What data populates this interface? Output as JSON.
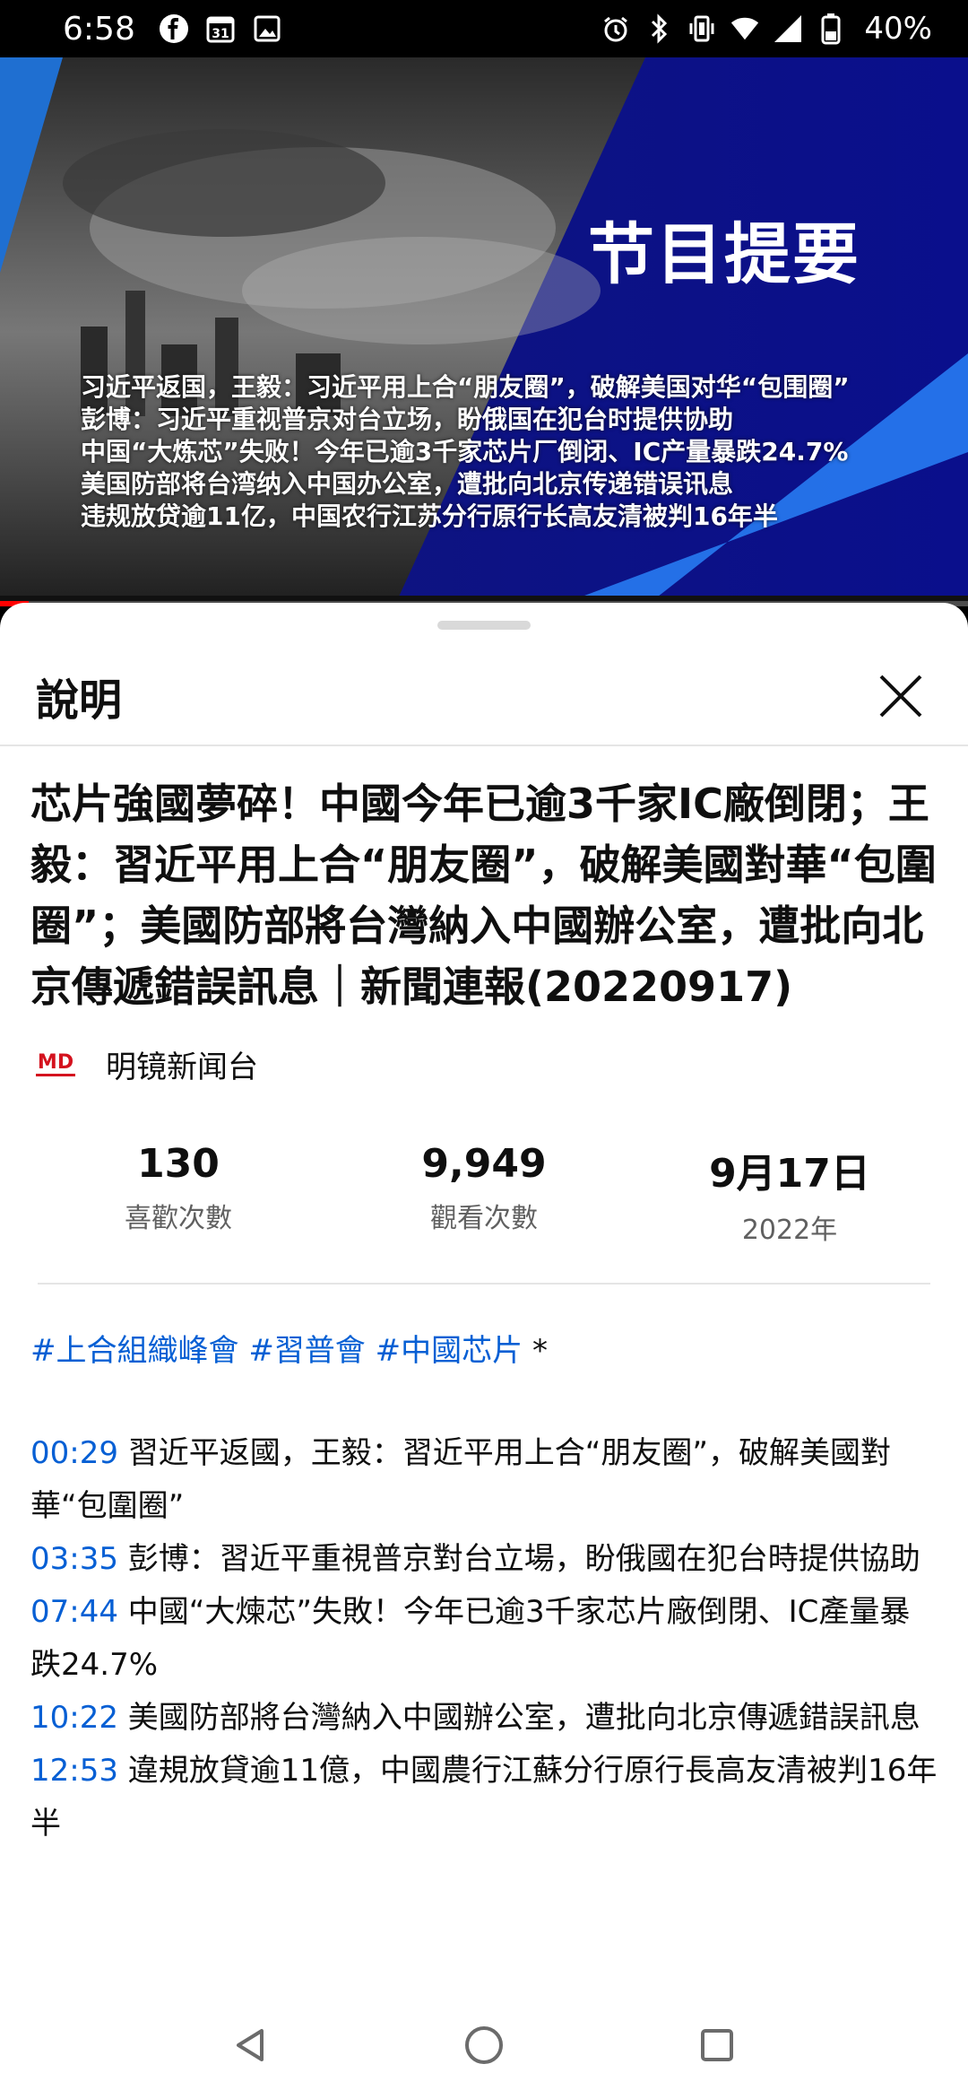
{
  "status_bar": {
    "time": "6:58",
    "left_icons": [
      "facebook-icon",
      "calendar-icon",
      "image-icon"
    ],
    "calendar_day": "31",
    "right_icons": [
      "alarm-icon",
      "bluetooth-icon",
      "vibrate-icon",
      "wifi-icon",
      "signal-icon",
      "battery-icon"
    ],
    "battery": "40%"
  },
  "video": {
    "title_overlay": "节目提要",
    "lines": [
      "习近平返国，王毅：习近平用上合“朋友圈”，破解美国对华“包围圈”",
      "彭博：习近平重视普京对台立场，盼俄国在犯台时提供协助",
      "中国“大炼芯”失败！今年已逾3千家芯片厂倒闭、IC产量暴跌24.7%",
      "美国防部将台湾纳入中国办公室，遭批向北京传递错误讯息",
      "违规放贷逾11亿，中国农行江苏分行原行长高友清被判16年半"
    ],
    "progress_fraction": 0.03,
    "progress_color": "#ff0000"
  },
  "sheet": {
    "header_title": "說明",
    "video_title": "芯片強國夢碎！中國今年已逾3千家IC廠倒閉；王毅：習近平用上合“朋友圈”，破解美國對華“包圍圈”；美國防部將台灣納入中國辦公室，遭批向北京傳遞錯誤訊息｜新聞連報(20220917)",
    "channel_name": "明镜新闻台",
    "stats": {
      "likes_value": "130",
      "likes_label": "喜歡次數",
      "views_value": "9,949",
      "views_label": "觀看次數",
      "date_value": "9月17日",
      "date_year": "2022年"
    },
    "hashtags": [
      "#上合組織峰會",
      "#習普會",
      "#中國芯片"
    ],
    "hashtag_suffix": "*",
    "chapters": [
      {
        "time": "00:29",
        "text": "習近平返國，王毅：習近平用上合“朋友圈”，破解美國對華“包圍圈”"
      },
      {
        "time": "03:35",
        "text": "彭博：習近平重視普京對台立場，盼俄國在犯台時提供協助"
      },
      {
        "time": "07:44",
        "text": "中國“大煉芯”失敗！今年已逾3千家芯片廠倒閉、IC產量暴跌24.7%"
      },
      {
        "time": "10:22",
        "text": "美國防部將台灣納入中國辦公室，遭批向北京傳遞錯誤訊息"
      },
      {
        "time": "12:53",
        "text": "違規放貸逾11億，中國農行江蘇分行原行長高友清被判16年半"
      }
    ],
    "link_color": "#065fd4"
  },
  "nav_bar": {
    "buttons": [
      "back-icon",
      "home-icon",
      "recents-icon"
    ]
  }
}
